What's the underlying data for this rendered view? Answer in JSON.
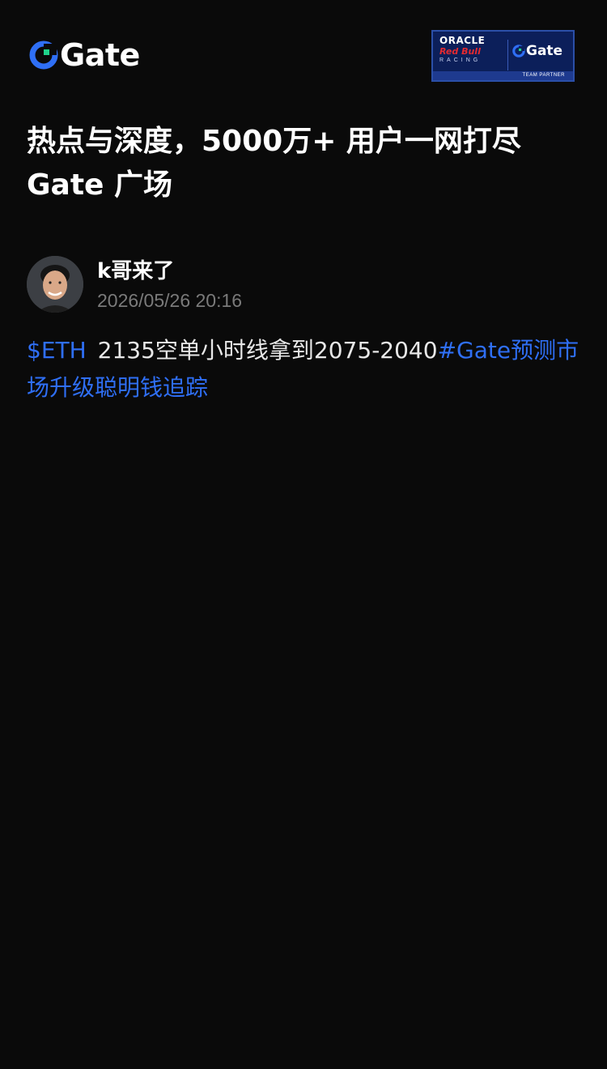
{
  "brand": {
    "logo_text": "Gate",
    "accent_color": "#2f6ff5"
  },
  "partner_badge": {
    "oracle": "ORACLE",
    "redbull": "Red Bull",
    "racing": "RACING",
    "gate": "Gate",
    "footer": "TEAM PARTNER"
  },
  "headline": {
    "line1": "热点与深度，5000万+ 用户一网打尽",
    "line2": "Gate 广场"
  },
  "post": {
    "author_name": "k哥来了",
    "timestamp": "2026/05/26 20:16",
    "ticker": "$ETH",
    "text": "2135空单小时线拿到2075-2040",
    "hashtag": "#Gate预测市场升级聪明钱追踪"
  }
}
